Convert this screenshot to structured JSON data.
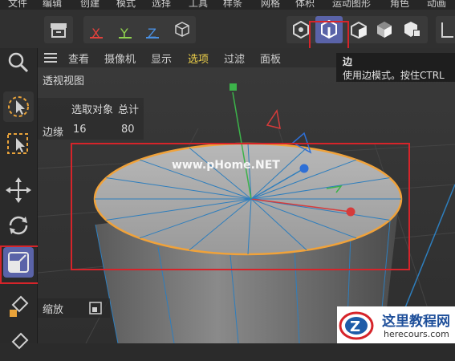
{
  "menubar": {
    "items": [
      "文件",
      "编辑",
      "创建",
      "模式",
      "选择",
      "工具",
      "样条",
      "网格",
      "体积",
      "运动图形",
      "角色",
      "动画"
    ]
  },
  "toolbar": {
    "axis_x": "X",
    "axis_y": "Y",
    "axis_z": "Z",
    "colors": {
      "x": "#e0413c",
      "y": "#8fd14f",
      "z": "#4a8fe0",
      "highlight": "#d6242a",
      "edge_mode_bg": "#5a63a8"
    }
  },
  "viewport_menu": {
    "items": [
      "查看",
      "摄像机",
      "显示",
      "选项",
      "过滤",
      "面板"
    ]
  },
  "viewport": {
    "name": "透视视图",
    "watermark": "www.pHome.NET"
  },
  "stats": {
    "col_selected": "选取对象",
    "col_total": "总计",
    "row_label": "边缘",
    "row_selected": "16",
    "row_total": "80"
  },
  "tooltip": {
    "title": "边",
    "description": "使用边模式。按住CTRL"
  },
  "bottom_hud": {
    "zoom_label": "缩放"
  },
  "logo": {
    "title": "这里教程网",
    "url": "herecours.com"
  }
}
